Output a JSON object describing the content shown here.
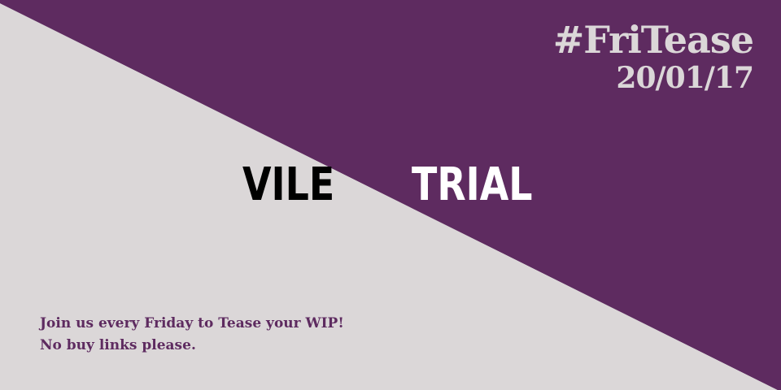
{
  "colors": {
    "purple": "#5e2b60",
    "light": "#dbd7d8"
  },
  "hashtag": "#FriTease",
  "date": "20/01/17",
  "title_left": "VILE",
  "title_right": "TRIAL",
  "footer": {
    "line1": "Join us every Friday to Tease your WIP!",
    "line2": "No buy links please."
  }
}
